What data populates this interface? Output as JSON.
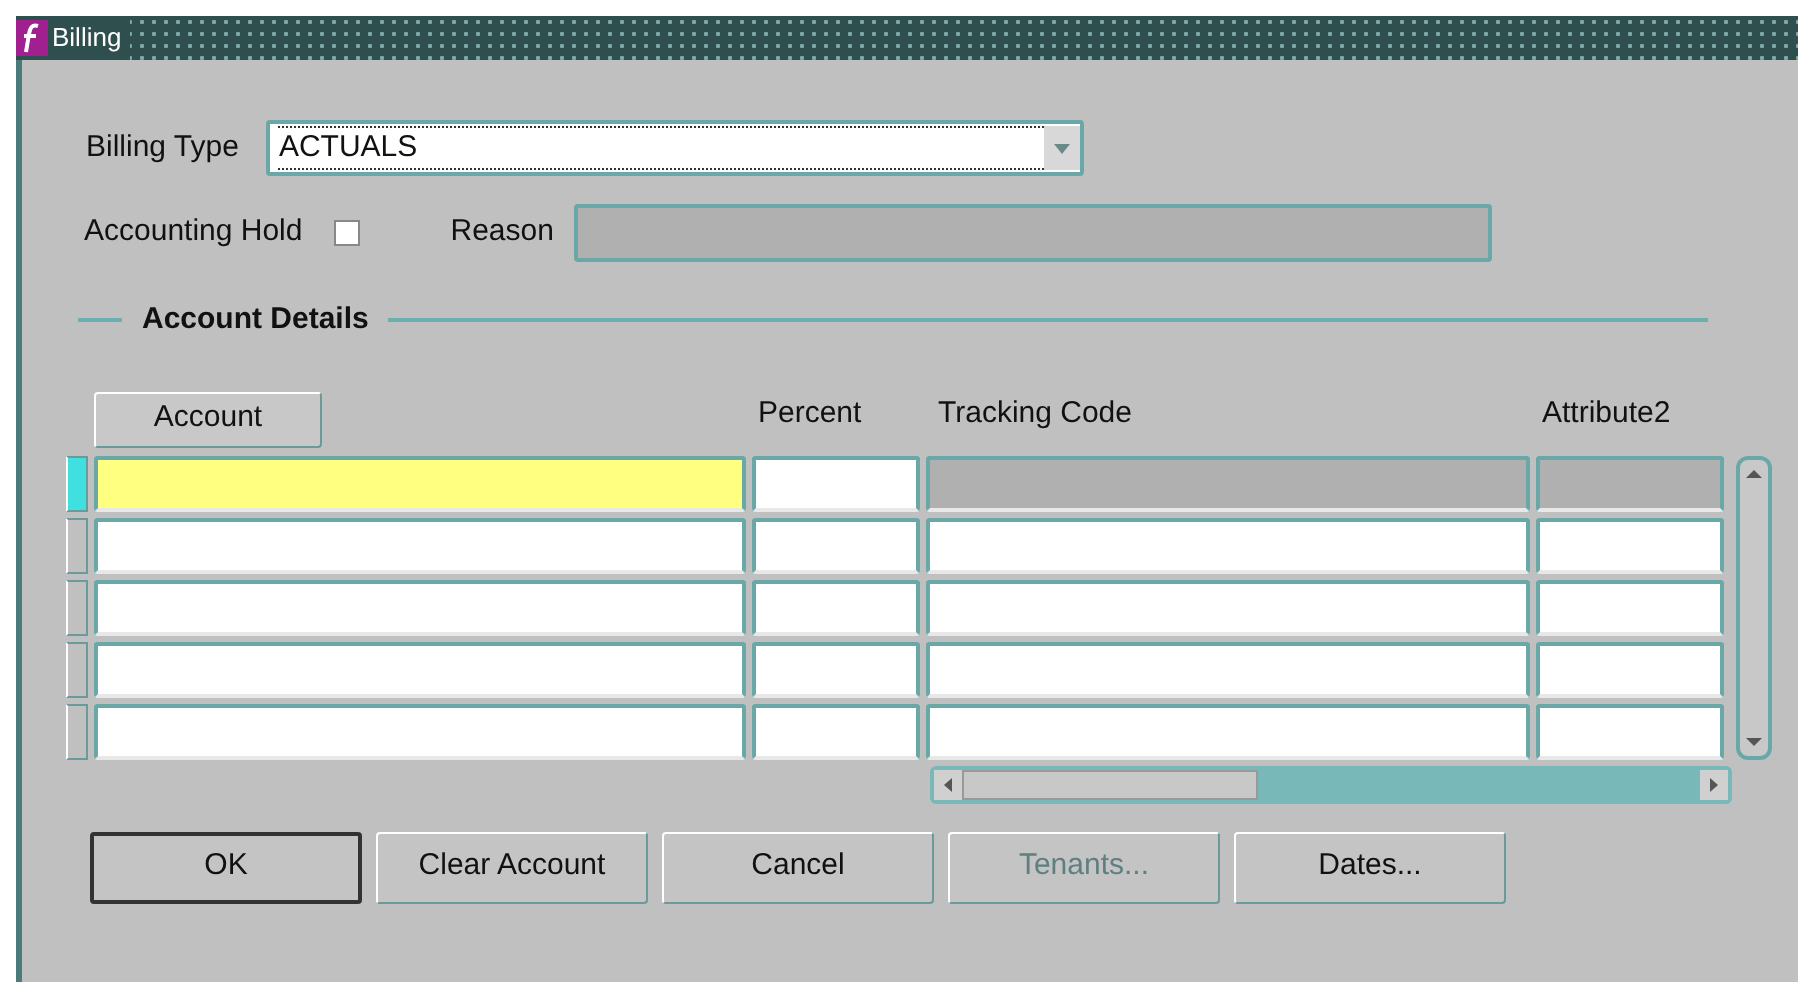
{
  "window": {
    "title": "Billing"
  },
  "billing_type": {
    "label": "Billing Type",
    "value": "ACTUALS"
  },
  "accounting_hold": {
    "label": "Accounting Hold",
    "checked": false
  },
  "reason": {
    "label": "Reason",
    "disabled": true
  },
  "account_details": {
    "title": "Account Details",
    "columns": [
      {
        "label": "Account",
        "kind": "button"
      },
      {
        "label": "Percent",
        "kind": "text"
      },
      {
        "label": "Tracking Code",
        "kind": "text"
      },
      {
        "label": "Attribute2",
        "kind": "text"
      }
    ],
    "rows": [
      {
        "selected": true,
        "locked": true
      },
      {
        "selected": false,
        "locked": false
      },
      {
        "selected": false,
        "locked": false
      },
      {
        "selected": false,
        "locked": false
      },
      {
        "selected": false,
        "locked": false
      }
    ]
  },
  "buttons": [
    {
      "label": "OK",
      "default": true,
      "disabled": false
    },
    {
      "label": "Clear Account",
      "default": false,
      "disabled": false
    },
    {
      "label": "Cancel",
      "default": false,
      "disabled": false
    },
    {
      "label": "Tenants...",
      "default": false,
      "disabled": true
    },
    {
      "label": "Dates...",
      "default": false,
      "disabled": false
    }
  ]
}
